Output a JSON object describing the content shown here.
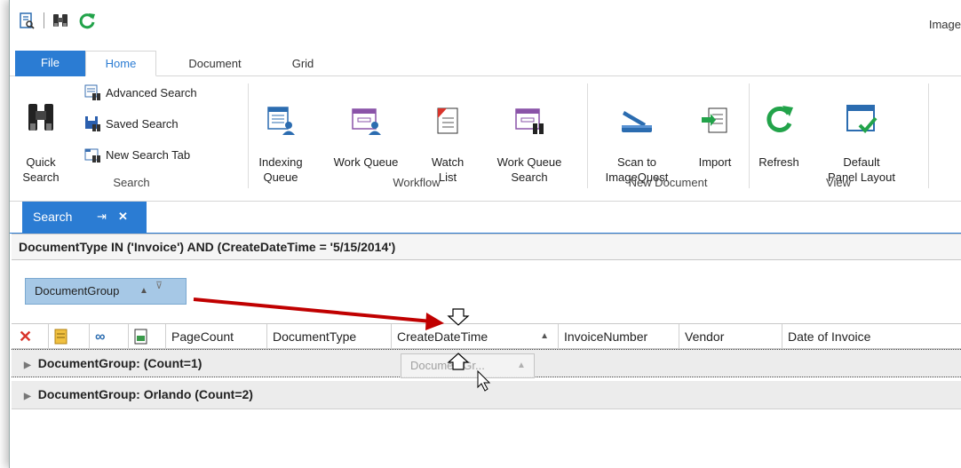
{
  "app_title": "Image",
  "toolbar_icons": [
    "search-document-icon",
    "binoculars-icon",
    "refresh-icon"
  ],
  "tabs": [
    {
      "label": "File"
    },
    {
      "label": "Home"
    },
    {
      "label": "Document"
    },
    {
      "label": "Grid"
    }
  ],
  "ribbon": {
    "search_group": {
      "label": "Search",
      "quick_search": "Quick\nSearch",
      "advanced_search": "Advanced Search",
      "saved_search": "Saved Search",
      "new_search_tab": "New Search Tab"
    },
    "workflow_group": {
      "label": "Workflow",
      "indexing_queue": "Indexing\nQueue",
      "work_queue": "Work Queue",
      "watch_list": "Watch\nList",
      "work_queue_search": "Work Queue\nSearch"
    },
    "new_document_group": {
      "label": "New Document",
      "scan_to": "Scan to\nImageQuest",
      "import": "Import"
    },
    "view_group": {
      "label": "View",
      "refresh": "Refresh",
      "default_panel_layout": "Default\nPanel Layout"
    }
  },
  "doc_tab": {
    "label": "Search",
    "pin": "⇥",
    "close": "✕"
  },
  "query": "DocumentType IN ('Invoice') AND (CreateDateTime = '5/15/2014')",
  "group_panel": {
    "chip_label": "DocumentGroup"
  },
  "columns": [
    "PageCount",
    "DocumentType",
    "CreateDateTime",
    "InvoiceNumber",
    "Vendor",
    "Date of Invoice"
  ],
  "drag_ghost": "DocumentGr...",
  "group_rows": [
    {
      "label": "DocumentGroup:  (Count=1)"
    },
    {
      "label": "DocumentGroup: Orlando (Count=2)"
    }
  ],
  "colors": {
    "accent": "#2b7cd3",
    "arrow": "#c00000",
    "chip": "#a6c8e6"
  }
}
